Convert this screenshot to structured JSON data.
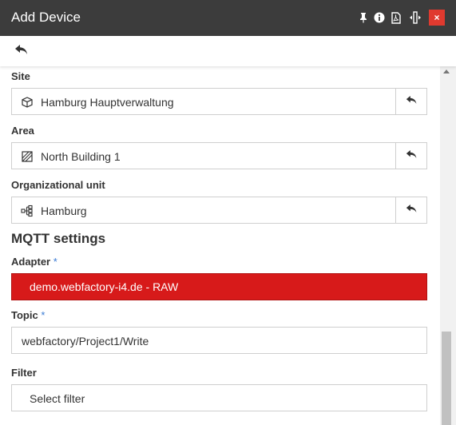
{
  "window": {
    "title": "Add Device",
    "icons": [
      "pin-icon",
      "info-icon",
      "pdf-icon",
      "resize-icon",
      "close-icon"
    ],
    "close_label": "×"
  },
  "toolbar": {
    "back_icon": "undo-icon"
  },
  "form": {
    "site": {
      "label": "Site",
      "value": "Hamburg Hauptverwaltung",
      "icon": "cube-icon"
    },
    "area": {
      "label": "Area",
      "value": "North Building 1",
      "icon": "area-icon"
    },
    "org_unit": {
      "label": "Organizational unit",
      "value": "Hamburg",
      "icon": "hierarchy-icon"
    }
  },
  "mqtt": {
    "heading": "MQTT settings",
    "adapter": {
      "label": "Adapter",
      "required": "*",
      "value": "demo.webfactory-i4.de - RAW"
    },
    "topic": {
      "label": "Topic",
      "required": "*",
      "value": "webfactory/Project1/Write"
    },
    "filter": {
      "label": "Filter",
      "placeholder": "Select filter"
    }
  },
  "colors": {
    "titlebar": "#3c3c3c",
    "close": "#e03a2f",
    "adapter": "#d71a1a",
    "required": "#3a7bd5"
  }
}
